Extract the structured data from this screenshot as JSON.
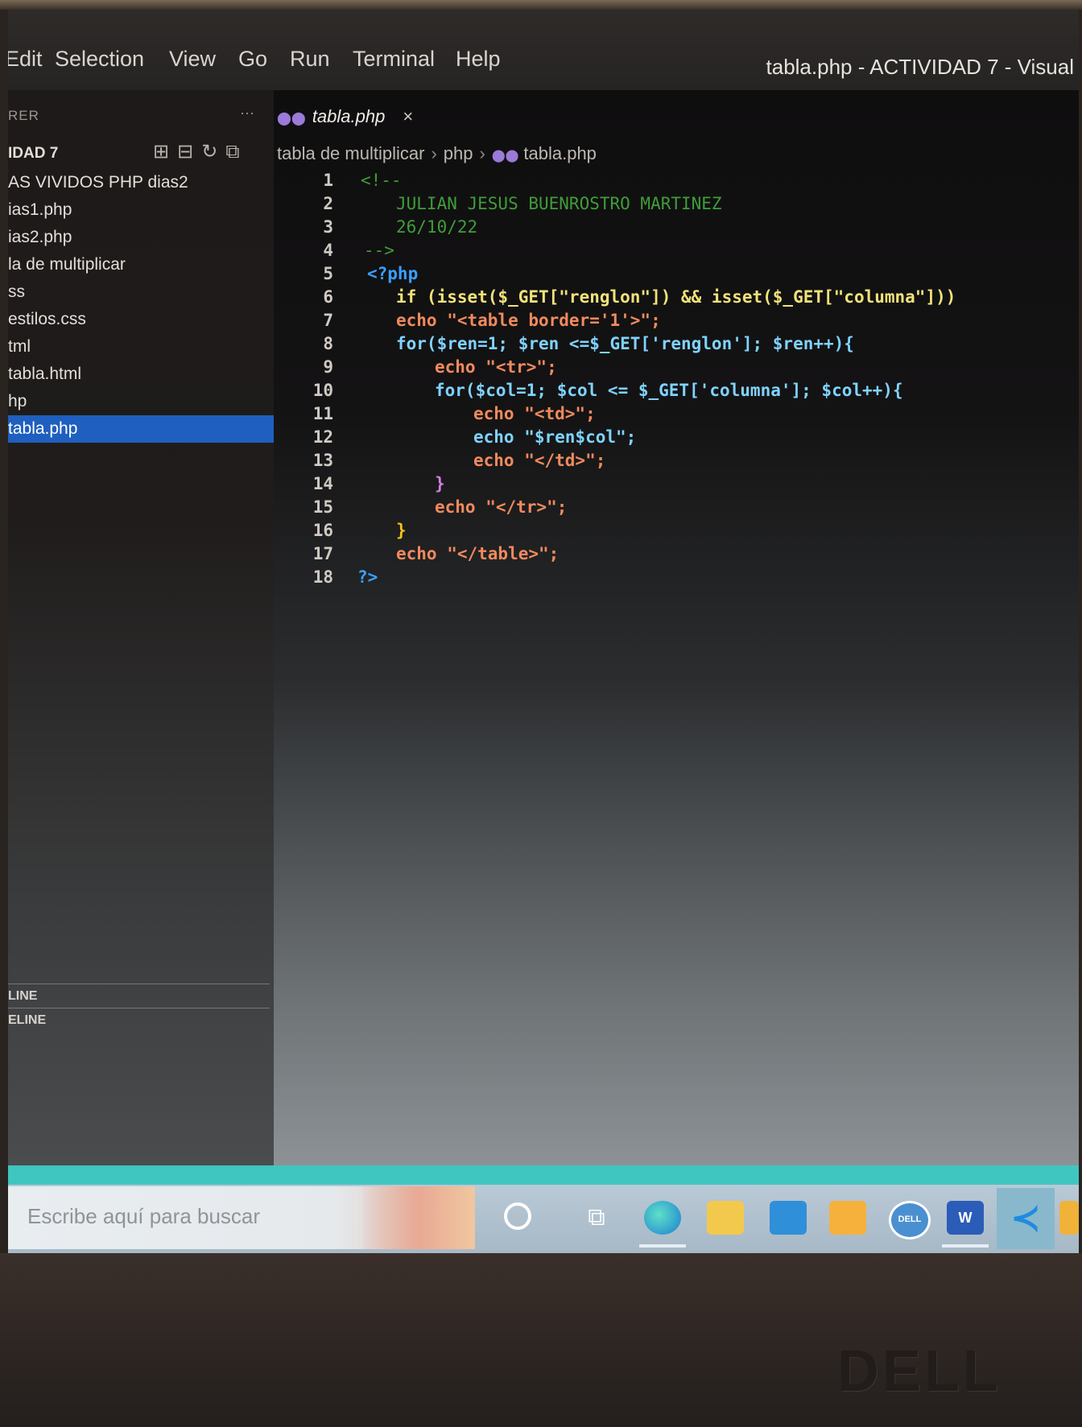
{
  "menubar": {
    "items": [
      "Edit",
      "Selection",
      "View",
      "Go",
      "Run",
      "Terminal",
      "Help"
    ],
    "window_title": "tabla.php - ACTIVIDAD 7 - Visual"
  },
  "sidebar": {
    "header": "RER",
    "project": "IDAD 7",
    "items": [
      "AS VIVIDOS  PHP  dias2",
      "ias1.php",
      "ias2.php",
      "la de multiplicar",
      "ss",
      "estilos.css",
      "tml",
      "tabla.html",
      "hp",
      "tabla.php"
    ],
    "outline_1": "LINE",
    "outline_2": "ELINE"
  },
  "editor": {
    "tab_label": "tabla.php",
    "tab_close": "×",
    "breadcrumb": [
      "tabla de multiplicar",
      "php",
      "tabla.php"
    ]
  },
  "code_lines": [
    {
      "n": "1",
      "text": "<!--"
    },
    {
      "n": "2",
      "text": "JULIAN JESUS BUENROSTRO MARTINEZ"
    },
    {
      "n": "3",
      "text": "26/10/22"
    },
    {
      "n": "4",
      "text": "-->"
    },
    {
      "n": "5",
      "text": "<?php"
    },
    {
      "n": "6",
      "text": "if (isset($_GET[\"renglon\"]) && isset($_GET[\"columna\"]))"
    },
    {
      "n": "7",
      "text": "echo \"<table border='1'>\";"
    },
    {
      "n": "8",
      "text": "for($ren=1; $ren <=$_GET['renglon']; $ren++){"
    },
    {
      "n": "9",
      "text": "echo \"<tr>\";"
    },
    {
      "n": "10",
      "text": "for($col=1; $col <= $_GET['columna']; $col++){"
    },
    {
      "n": "11",
      "text": "echo \"<td>\";"
    },
    {
      "n": "12",
      "text": "echo \"$ren$col\";"
    },
    {
      "n": "13",
      "text": "echo \"</td>\";"
    },
    {
      "n": "14",
      "text": "}"
    },
    {
      "n": "15",
      "text": "echo \"</tr>\";"
    },
    {
      "n": "16",
      "text": "}"
    },
    {
      "n": "17",
      "text": "echo \"</table>\";"
    },
    {
      "n": "18",
      "text": "?>"
    }
  ],
  "taskbar": {
    "search_placeholder": "Escribe aquí para buscar",
    "icons": [
      "search-circle-icon",
      "task-view-icon",
      "edge-icon",
      "file-explorer-icon",
      "mail-icon",
      "store-icon",
      "dell-icon",
      "word-icon",
      "vscode-icon",
      "other-app-icon"
    ],
    "dell_label": "DELL",
    "word_label": "W"
  },
  "bezel": {
    "brand": "DELL"
  }
}
